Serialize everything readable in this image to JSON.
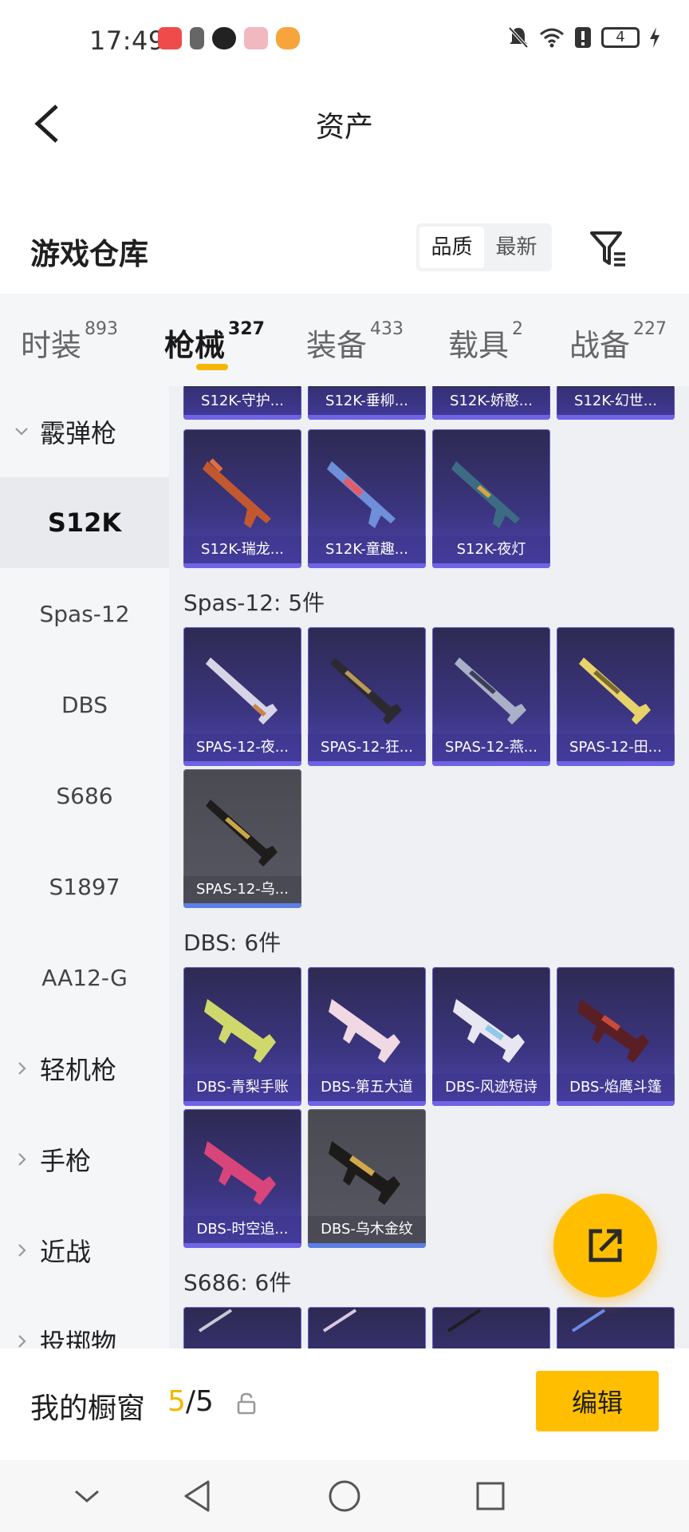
{
  "status_bar": {
    "time": "17:49",
    "battery": "4"
  },
  "header": {
    "title": "资产"
  },
  "warehouse": {
    "title": "游戏仓库",
    "sort_options": [
      "品质",
      "最新"
    ]
  },
  "tabs": [
    {
      "label": "时装",
      "count": "893"
    },
    {
      "label": "枪械",
      "count": "327"
    },
    {
      "label": "装备",
      "count": "433"
    },
    {
      "label": "载具",
      "count": "2"
    },
    {
      "label": "战备",
      "count": "227"
    }
  ],
  "sidebar": {
    "group_shotgun": "霰弹枪",
    "items": [
      "S12K",
      "Spas-12",
      "DBS",
      "S686",
      "S1897",
      "AA12-G"
    ],
    "group_lmg": "轻机枪",
    "group_pistol": "手枪",
    "group_melee": "近战",
    "group_throwable": "投掷物"
  },
  "content": {
    "s12k_top_row": [
      "S12K-守护...",
      "S12K-垂柳...",
      "S12K-娇憨...",
      "S12K-幻世..."
    ],
    "s12k_row2": [
      "S12K-瑞龙...",
      "S12K-童趣...",
      "S12K-夜灯"
    ],
    "spas_title": "Spas-12: 5件",
    "spas_row1": [
      "SPAS-12-夜...",
      "SPAS-12-狂...",
      "SPAS-12-燕...",
      "SPAS-12-田..."
    ],
    "spas_row2": [
      "SPAS-12-乌..."
    ],
    "dbs_title": "DBS: 6件",
    "dbs_row1": [
      "DBS-青梨手账",
      "DBS-第五大道",
      "DBS-风迹短诗",
      "DBS-焰鹰斗篷"
    ],
    "dbs_row2": [
      "DBS-时空追...",
      "DBS-乌木金纹"
    ],
    "s686_title": "S686: 6件"
  },
  "bottom": {
    "showcase_label": "我的橱窗",
    "showcase_num": "5",
    "showcase_total": "/5",
    "edit_label": "编辑"
  },
  "colors": {
    "accent": "#ffbf00",
    "card_purple": "#3b3580",
    "card_grey": "#585864"
  }
}
